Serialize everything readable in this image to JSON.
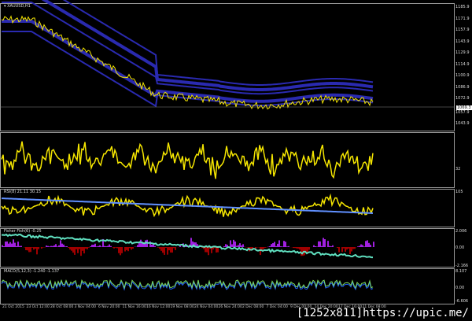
{
  "symbol": "XAUUSD,H1",
  "price_axis": [
    "1185.9",
    "1171.9",
    "1157.9",
    "1143.9",
    "1129.9",
    "1114.9",
    "1100.9",
    "1086.9",
    "1072.9",
    "1057.9",
    "1043.9"
  ],
  "current_price": "1069.3",
  "pane2": {
    "level": "32"
  },
  "pane3": {
    "title": "RSI(8) 21.11 30.15",
    "level": "105"
  },
  "pane4": {
    "title": "Fisher Fish(6) -0.25",
    "top": "2.006",
    "mid": "0.00",
    "bottom": "-2.166"
  },
  "pane5": {
    "title": "MACD(5,12,3) -1.240 -1.137",
    "top": "8.107",
    "mid": "0.00",
    "bottom": "-6.606"
  },
  "time_axis": [
    "21 Oct 2015",
    "23 Oct 12:00",
    "28 Oct 08:00",
    "3 Nov 04:00",
    "6 Nov 20:00",
    "11 Nov 16:00",
    "16 Nov 12:00",
    "19 Nov 08:00",
    "24 Nov 04:00",
    "26 Nov 24:00",
    "2 Dec 08:00",
    "7 Dec 04:00",
    "9 Dec 00:00",
    "14 Dec 20:00",
    "17 Dec 16:00",
    "21 Dec 08:00"
  ],
  "watermark": "[1252x811]https://upic.me/",
  "colors": {
    "bands": "#2a2ab0",
    "candles_up": "#22c040",
    "candles_down": "#d02020",
    "yellow": "#f5e600",
    "purple": "#a020e0",
    "darkred": "#a00000",
    "aqua": "#60e0c0",
    "macd_blue": "#2060ff"
  }
}
